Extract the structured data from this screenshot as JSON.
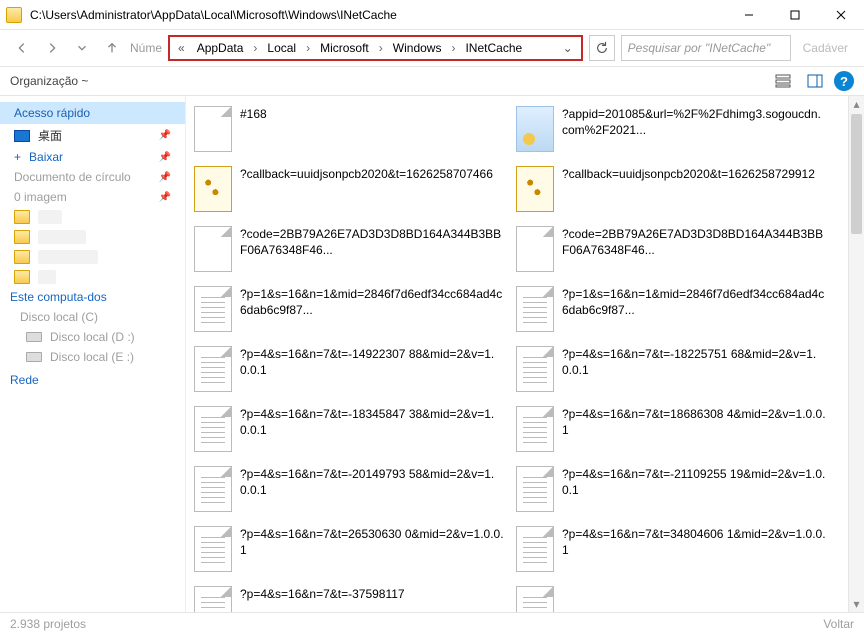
{
  "window": {
    "title": "C:\\Users\\Administrator\\AppData\\Local\\Microsoft\\Windows\\INetCache"
  },
  "nav": {
    "number_label": "Núme",
    "crumbs": [
      "AppData",
      "Local",
      "Microsoft",
      "Windows",
      "INetCache"
    ],
    "search_placeholder": "Pesquisar por \"INetCache\"",
    "cadaver": "Cadáver"
  },
  "toolbar": {
    "organize": "Organização ~"
  },
  "sidebar": {
    "quick_access": "Acesso rápido",
    "desktop": "桌面",
    "download": "Baixar",
    "documents": "Documento de círculo",
    "images": "0 imagem",
    "this_pc": "Este computa-dos",
    "local_c_label": "Disco local (C)",
    "local_d": "Disco local (D :)",
    "local_e": "Disco local (E :)",
    "network": "Rede"
  },
  "files": [
    [
      {
        "icon": "blank",
        "name": "#168"
      },
      {
        "icon": "img",
        "name": "?appid=201085&url=%2F%2Fdhimg3.sogoucdn.com%2F2021..."
      }
    ],
    [
      {
        "icon": "script",
        "name": "?callback=uuidjsonpcb2020&t=1626258707466"
      },
      {
        "icon": "script",
        "name": "?callback=uuidjsonpcb2020&t=1626258729912"
      }
    ],
    [
      {
        "icon": "blank",
        "name": "?code=2BB79A26E7AD3D3D8BD164A344B3BBF06A76348F46..."
      },
      {
        "icon": "blank",
        "name": "?code=2BB79A26E7AD3D3D8BD164A344B3BBF06A76348F46..."
      }
    ],
    [
      {
        "icon": "txt",
        "name": "?p=1&s=16&n=1&mid=2846f7d6edf34cc684ad4c6dab6c9f87..."
      },
      {
        "icon": "txt",
        "name": "?p=1&s=16&n=1&mid=2846f7d6edf34cc684ad4c6dab6c9f87..."
      }
    ],
    [
      {
        "icon": "txt",
        "name": "?p=4&s=16&n=7&t=-14922307 88&mid=2&v=1.0.0.1"
      },
      {
        "icon": "txt",
        "name": "?p=4&s=16&n=7&t=-18225751 68&mid=2&v=1.0.0.1"
      }
    ],
    [
      {
        "icon": "txt",
        "name": "?p=4&s=16&n=7&t=-18345847 38&mid=2&v=1.0.0.1"
      },
      {
        "icon": "txt",
        "name": "?p=4&s=16&n=7&t=18686308 4&mid=2&v=1.0.0.1"
      }
    ],
    [
      {
        "icon": "txt",
        "name": "?p=4&s=16&n=7&t=-20149793 58&mid=2&v=1.0.0.1"
      },
      {
        "icon": "txt",
        "name": "?p=4&s=16&n=7&t=-21109255 19&mid=2&v=1.0.0.1"
      }
    ],
    [
      {
        "icon": "txt",
        "name": "?p=4&s=16&n=7&t=26530630 0&mid=2&v=1.0.0.1"
      },
      {
        "icon": "txt",
        "name": "?p=4&s=16&n=7&t=34804606 1&mid=2&v=1.0.0.1"
      }
    ],
    [
      {
        "icon": "txt",
        "name": "?p=4&s=16&n=7&t=-37598117"
      },
      {
        "icon": "txt",
        "name": ""
      }
    ]
  ],
  "status": {
    "count": "2.938 projetos",
    "back": "Voltar"
  }
}
